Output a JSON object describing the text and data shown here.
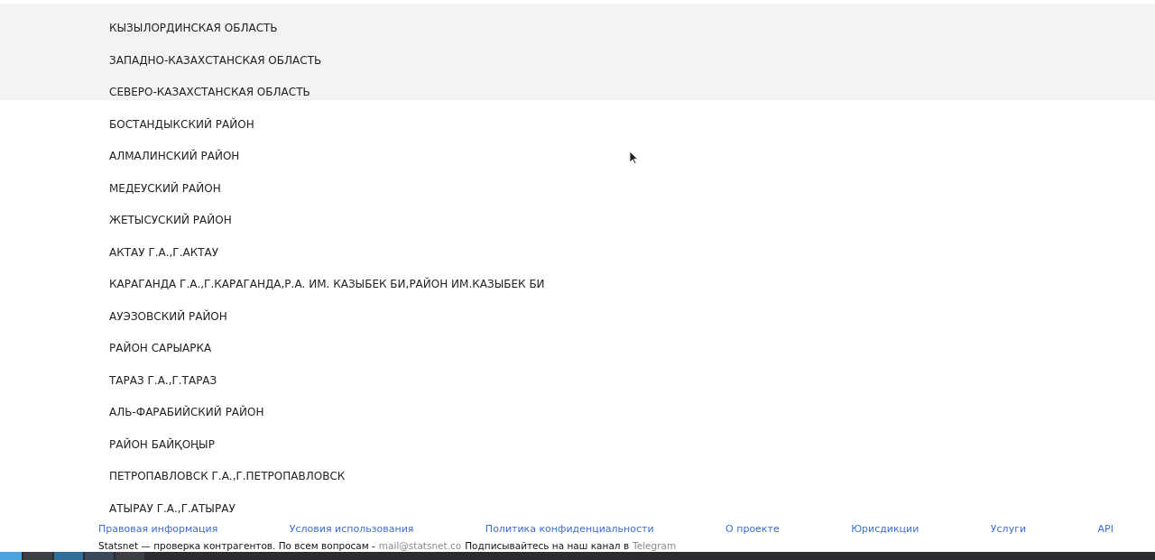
{
  "regions": [
    {
      "name": "КЫЗЫЛОРДИНСКАЯ ОБЛАСТЬ",
      "shaded": true
    },
    {
      "name": "ЗАПАДНО-КАЗАХСТАНСКАЯ ОБЛАСТЬ",
      "shaded": true
    },
    {
      "name": "СЕВЕРО-КАЗАХСТАНСКАЯ ОБЛАСТЬ",
      "shaded": true
    },
    {
      "name": "БОСТАНДЫКСКИЙ РАЙОН",
      "shaded": false
    },
    {
      "name": "АЛМАЛИНСКИЙ РАЙОН",
      "shaded": false
    },
    {
      "name": "МЕДЕУСКИЙ РАЙОН",
      "shaded": false
    },
    {
      "name": "ЖЕТЫСУСКИЙ РАЙОН",
      "shaded": false
    },
    {
      "name": "АКТАУ Г.А.,Г.АКТАУ",
      "shaded": false
    },
    {
      "name": "КАРАГАНДА Г.А.,Г.КАРАГАНДА,Р.А. ИМ. КАЗЫБЕК БИ,РАЙОН ИМ.КАЗЫБЕК БИ",
      "shaded": false
    },
    {
      "name": "АУЭЗОВСКИЙ РАЙОН",
      "shaded": false
    },
    {
      "name": "РАЙОН САРЫАРКА",
      "shaded": false
    },
    {
      "name": "ТАРАЗ Г.А.,Г.ТАРАЗ",
      "shaded": false
    },
    {
      "name": "АЛЬ-ФАРАБИЙСКИЙ РАЙОН",
      "shaded": false
    },
    {
      "name": "РАЙОН БАЙҚОҢЫР",
      "shaded": false
    },
    {
      "name": "ПЕТРОПАВЛОВСК Г.А.,Г.ПЕТРОПАВЛОВСК",
      "shaded": false
    },
    {
      "name": "АТЫРАУ Г.А.,Г.АТЫРАУ",
      "shaded": false
    }
  ],
  "footer": {
    "links": [
      "Правовая информация",
      "Условия использования",
      "Политика конфиденциальности",
      "О проекте",
      "Юрисдикции",
      "Услуги",
      "API"
    ],
    "note": {
      "text": "Statsnet — проверка контрагентов.  По всем вопросам -",
      "email": "mail@statsnet.co",
      "subscribe": "Подписывайтесь на наш канал в",
      "channel": "Telegram"
    }
  }
}
